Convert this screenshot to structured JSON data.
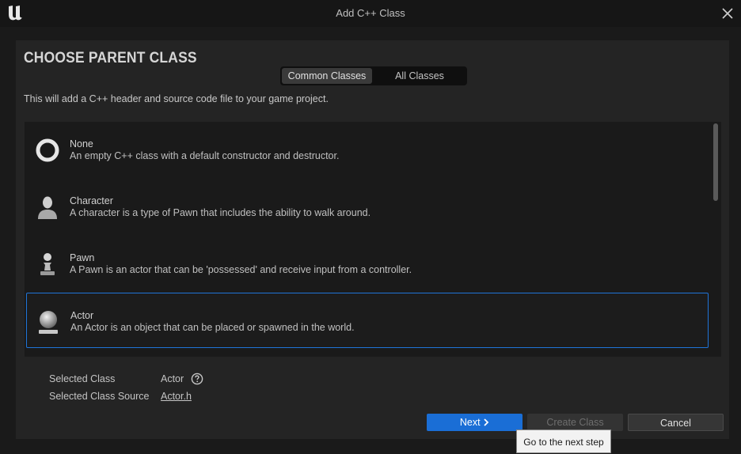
{
  "window": {
    "title": "Add C++ Class",
    "logo_icon": "unreal-engine-logo",
    "close_icon": "close-icon"
  },
  "header": {
    "heading": "CHOOSE PARENT CLASS",
    "tabs": [
      {
        "label": "Common Classes",
        "active": true
      },
      {
        "label": "All Classes",
        "active": false
      }
    ],
    "description": "This will add a C++ header and source code file to your game project."
  },
  "classes": [
    {
      "name": "None",
      "description": "An empty C++ class with a default constructor and destructor.",
      "icon": "ring-icon",
      "selected": false
    },
    {
      "name": "Character",
      "description": "A character is a type of Pawn that includes the ability to walk around.",
      "icon": "character-icon",
      "selected": false
    },
    {
      "name": "Pawn",
      "description": "A Pawn is an actor that can be 'possessed' and receive input from a controller.",
      "icon": "pawn-icon",
      "selected": false
    },
    {
      "name": "Actor",
      "description": "An Actor is an object that can be placed or spawned in the world.",
      "icon": "actor-sphere-icon",
      "selected": true
    }
  ],
  "selection": {
    "class_label": "Selected Class",
    "class_value": "Actor",
    "source_label": "Selected Class Source",
    "source_value": "Actor.h"
  },
  "buttons": {
    "next": "Next",
    "next_icon": "chevron-right-icon",
    "create": "Create Class",
    "cancel": "Cancel"
  },
  "tooltip": "Go to the next step",
  "colors": {
    "accent": "#1a6ed6",
    "selection_border": "#1f74d8"
  }
}
